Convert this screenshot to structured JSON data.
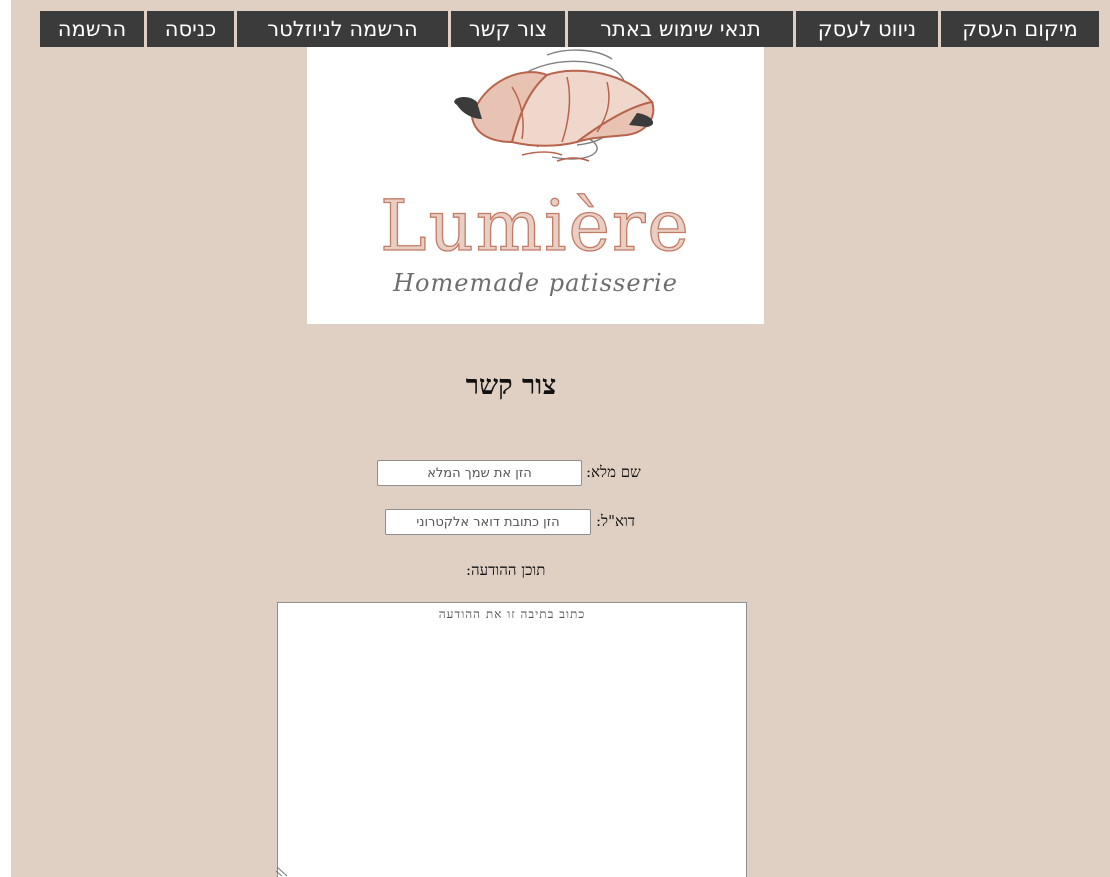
{
  "nav": {
    "items": [
      {
        "id": "location",
        "label": "מיקום העסק"
      },
      {
        "id": "directions",
        "label": "ניווט לעסק"
      },
      {
        "id": "terms",
        "label": "תנאי שימוש באתר"
      },
      {
        "id": "contact",
        "label": "צור קשר"
      },
      {
        "id": "newsletter",
        "label": "הרשמה לניוזלטר"
      },
      {
        "id": "login",
        "label": "כניסה"
      },
      {
        "id": "register",
        "label": "הרשמה"
      }
    ]
  },
  "logo": {
    "name": "Lumière",
    "tagline": "Homemade patisserie",
    "icon": "croissant-icon"
  },
  "page_title": "צור קשר",
  "form": {
    "name_label": "שם מלא:",
    "name_placeholder": "הזן את שמך המלא",
    "email_label": "דוא\"ל:",
    "email_placeholder": "הזן כתובת דואר אלקטרוני",
    "message_label": "תוכן ההודעה:",
    "message_placeholder": "כתוב בתיבה זו את ההודעה"
  },
  "colors": {
    "page_background": "#e0d0c3",
    "nav_background": "#3b3b3b",
    "nav_text": "#ffffff",
    "logo_accent": "#c47b66"
  }
}
